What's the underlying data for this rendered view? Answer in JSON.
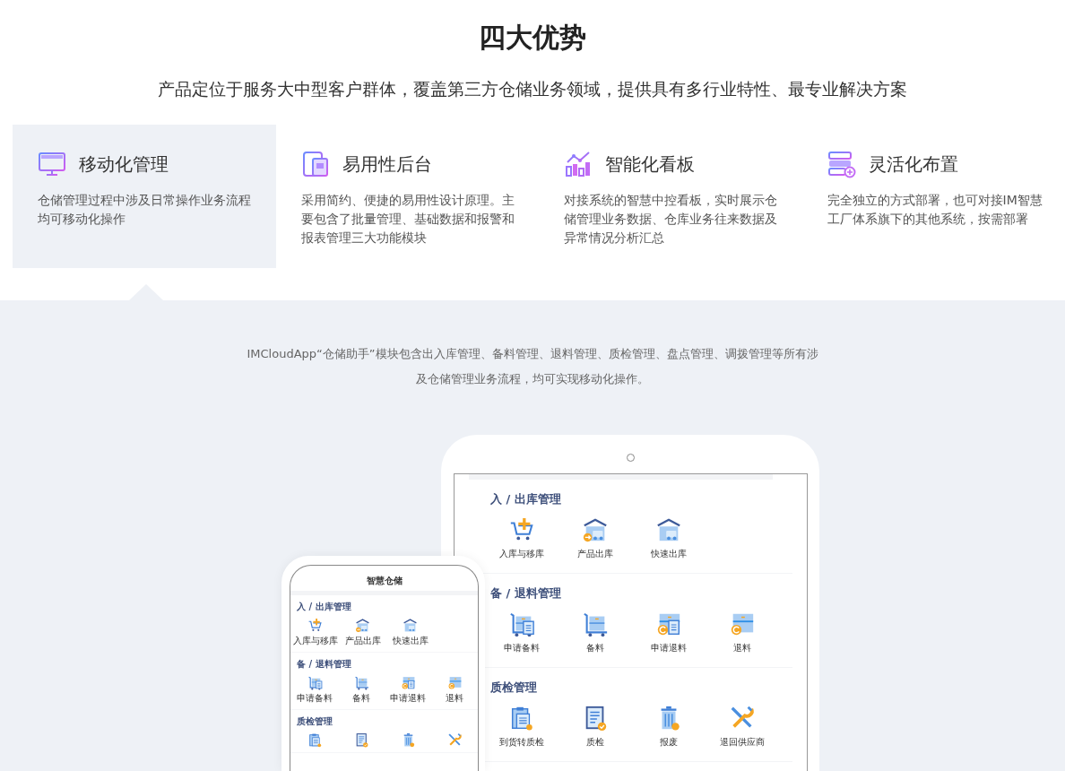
{
  "heading": "四大优势",
  "subheading": "产品定位于服务大中型客户群体，覆盖第三方仓储业务领域，提供具有多行业特性、最专业解决方案",
  "features": [
    {
      "title": "移动化管理",
      "description": "仓储管理过程中涉及日常操作业务流程均可移动化操作",
      "selected": true
    },
    {
      "title": "易用性后台",
      "description": "采用简约、便捷的易用性设计原理。主要包含了批量管理、基础数据和报警和报表管理三大功能模块",
      "selected": false
    },
    {
      "title": "智能化看板",
      "description": "对接系统的智慧中控看板，实时展示仓储管理业务数据、仓库业务往来数据及异常情况分析汇总",
      "selected": false
    },
    {
      "title": "灵活化布置",
      "description": "完全独立的方式部署，也可对接IM智慧工厂体系旗下的其他系统，按需部署",
      "selected": false
    }
  ],
  "intro": [
    "IMCloudApp“仓储助手”模块包含出入库管理、备料管理、退料管理、质检管理、盘点管理、调拨管理等所有涉",
    "及仓储管理业务流程，均可实现移动化操作。"
  ],
  "tablet": {
    "sections": [
      {
        "title": "入 / 出库管理",
        "items": [
          {
            "label": "入库与移库"
          },
          {
            "label": "产品出库"
          },
          {
            "label": "快速出库"
          }
        ]
      },
      {
        "title": "备 / 退料管理",
        "items": [
          {
            "label": "申请备料"
          },
          {
            "label": "备料"
          },
          {
            "label": "申请退料"
          },
          {
            "label": "退料"
          }
        ]
      },
      {
        "title": "质检管理",
        "items": [
          {
            "label": "到货转质检"
          },
          {
            "label": "质检"
          },
          {
            "label": "报废"
          },
          {
            "label": "退回供应商"
          }
        ]
      }
    ]
  },
  "phone": {
    "title": "智慧仓储",
    "sections": [
      {
        "title": "入 / 出库管理",
        "items": [
          {
            "label": "入库与移库"
          },
          {
            "label": "产品出库"
          },
          {
            "label": "快速出库"
          }
        ]
      },
      {
        "title": "备 / 退料管理",
        "items": [
          {
            "label": "申请备料"
          },
          {
            "label": "备料"
          },
          {
            "label": "申请退料"
          },
          {
            "label": "退料"
          }
        ]
      },
      {
        "title": "质检管理",
        "items": [
          {
            "kind": "icon-only"
          },
          {
            "kind": "icon-only"
          },
          {
            "kind": "icon-only"
          },
          {
            "kind": "icon-only"
          }
        ]
      }
    ]
  }
}
